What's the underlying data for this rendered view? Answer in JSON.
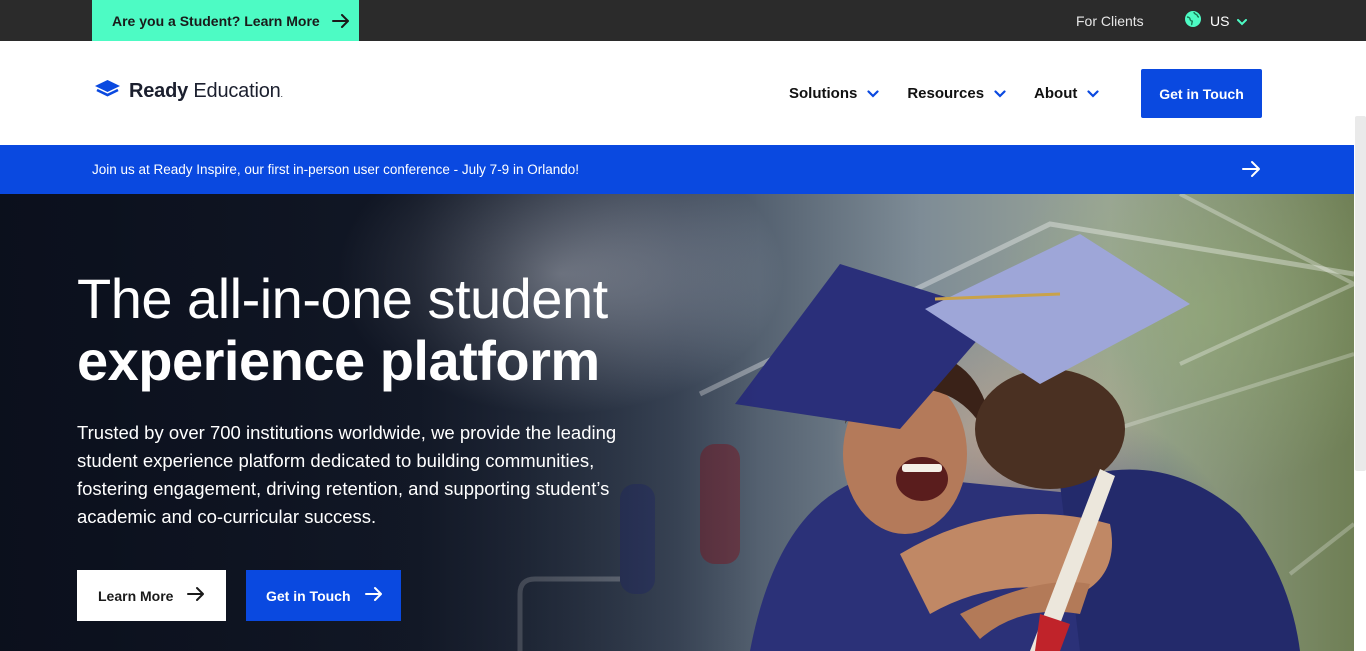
{
  "topbar": {
    "student_cta": "Are you a Student? Learn More",
    "for_clients": "For Clients",
    "locale": "US"
  },
  "header": {
    "logo_bold": "Ready",
    "logo_regular": "Education",
    "logo_mark": ".",
    "nav": [
      {
        "label": "Solutions"
      },
      {
        "label": "Resources"
      },
      {
        "label": "About"
      }
    ],
    "cta": "Get in Touch"
  },
  "announcement": {
    "text": "Join us at Ready Inspire, our first in-person user conference - July 7-9 in Orlando!"
  },
  "hero": {
    "title_line1": "The all-in-one student",
    "title_line2": "experience platform",
    "description": "Trusted by over 700 institutions worldwide, we provide the leading student experience platform dedicated to building communities, fostering engagement, driving retention, and supporting student’s academic and co-curricular success.",
    "primary_button": "Learn More",
    "secondary_button": "Get in Touch"
  },
  "colors": {
    "brand_blue": "#0a49e0",
    "mint": "#4dfbc4",
    "topbar": "#2b2b2b"
  }
}
